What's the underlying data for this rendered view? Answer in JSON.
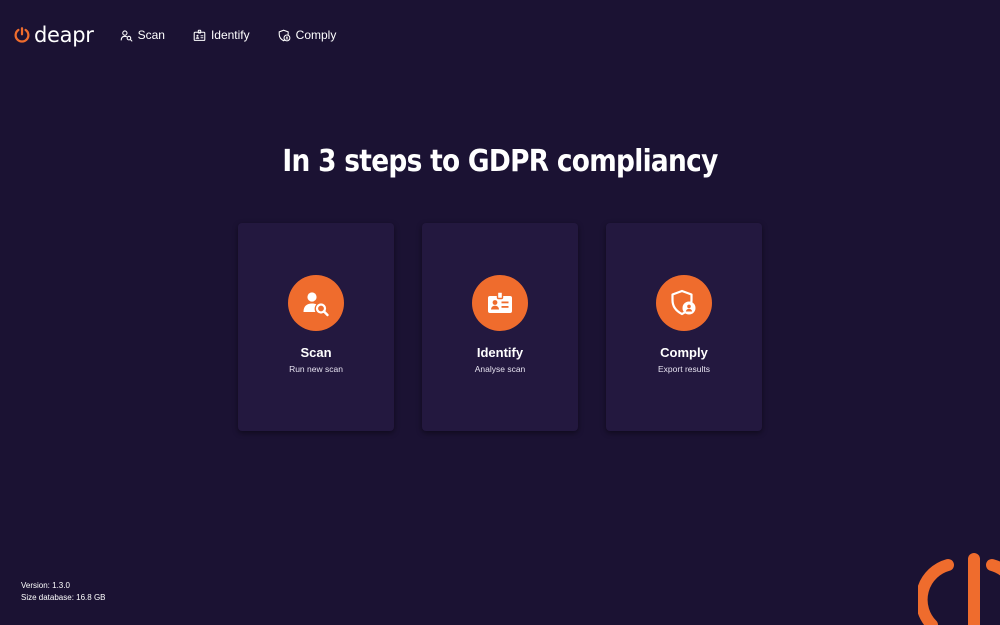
{
  "app": {
    "logo_text": "deapr",
    "brand_color": "#ef6c2d",
    "background_color": "#1b1233",
    "card_color": "#23183f"
  },
  "nav": {
    "items": [
      {
        "label": "Scan",
        "icon": "user-search-icon"
      },
      {
        "label": "Identify",
        "icon": "id-badge-icon"
      },
      {
        "label": "Comply",
        "icon": "shield-user-icon"
      }
    ]
  },
  "main": {
    "headline": "In 3 steps to GDPR compliancy",
    "cards": [
      {
        "title": "Scan",
        "subtitle": "Run new scan",
        "icon": "user-search-icon"
      },
      {
        "title": "Identify",
        "subtitle": "Analyse scan",
        "icon": "id-badge-icon"
      },
      {
        "title": "Comply",
        "subtitle": "Export results",
        "icon": "shield-user-icon"
      }
    ]
  },
  "footer": {
    "version": "Version: 1.3.0",
    "database_size": "Size database: 16.8 GB"
  }
}
